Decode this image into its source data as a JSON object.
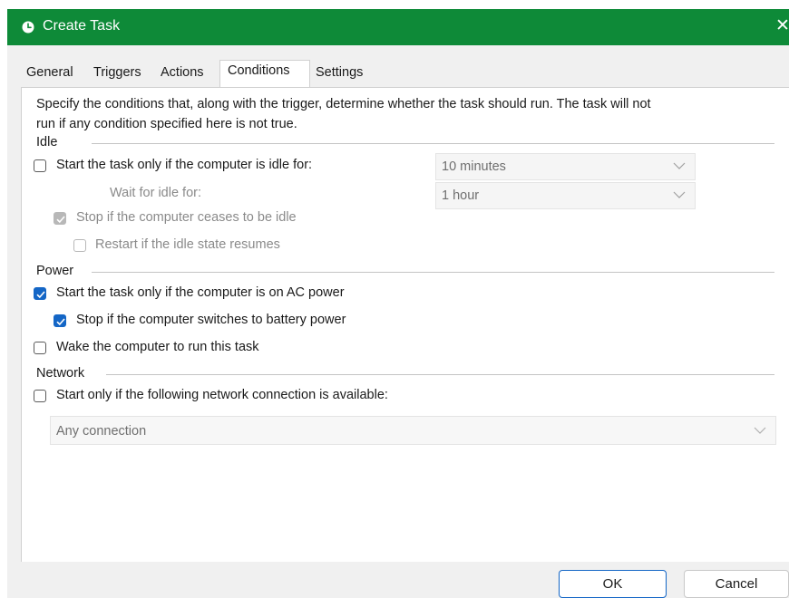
{
  "window": {
    "title": "Create Task",
    "icon": "clock-icon",
    "close_glyph": "✕",
    "accent": "#0e8a38"
  },
  "tabs": [
    {
      "label": "General"
    },
    {
      "label": "Triggers"
    },
    {
      "label": "Actions"
    },
    {
      "label": "Conditions",
      "active": true
    },
    {
      "label": "Settings"
    }
  ],
  "description": {
    "line1": "Specify the conditions that, along with the trigger, determine whether the task should run.  The task will not",
    "line2": "run  if any condition specified here is not true."
  },
  "idle": {
    "group_label": "Idle",
    "start_if_idle": {
      "label": "Start the task only if the computer is idle for:",
      "checked": false,
      "enabled": true
    },
    "idle_duration": {
      "value": "10 minutes",
      "enabled": false
    },
    "wait_label": "Wait for idle for:",
    "wait_duration": {
      "value": "1 hour",
      "enabled": false
    },
    "stop_if_not_idle": {
      "label": "Stop if the computer ceases to be idle",
      "checked": true,
      "enabled": false
    },
    "restart_if_idle": {
      "label": "Restart if the idle state resumes",
      "checked": false,
      "enabled": false
    }
  },
  "power": {
    "group_label": "Power",
    "ac_power": {
      "label": "Start the task only if the computer is on AC power",
      "checked": true
    },
    "stop_on_battery": {
      "label": "Stop if the computer switches to battery power",
      "checked": true
    },
    "wake": {
      "label": "Wake the computer to run this task",
      "checked": false
    }
  },
  "network": {
    "group_label": "Network",
    "start_if_network": {
      "label": "Start only if the following network connection is available:",
      "checked": false
    },
    "connection": {
      "value": "Any connection",
      "enabled": false
    }
  },
  "buttons": {
    "ok": "OK",
    "cancel": "Cancel"
  },
  "colors": {
    "checkbox_checked": "#1466c6",
    "primary_button_border": "#1466c6"
  }
}
